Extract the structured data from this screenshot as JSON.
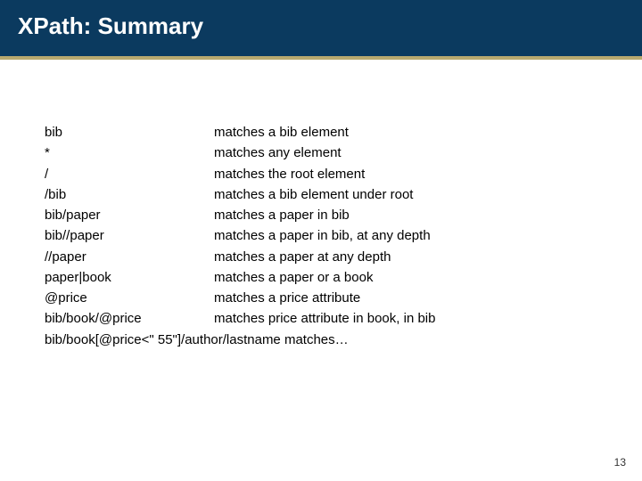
{
  "title": "XPath: Summary",
  "rows": [
    {
      "l": "bib",
      "r": "matches a bib element"
    },
    {
      "l": "*",
      "r": "matches any element"
    },
    {
      "l": "/",
      "r": "matches the root element"
    },
    {
      "l": "/bib",
      "r": "matches a bib element under root"
    },
    {
      "l": "bib/paper",
      "r": "matches a paper in bib"
    },
    {
      "l": "bib//paper",
      "r": "matches a paper in bib, at any depth"
    },
    {
      "l": "//paper",
      "r": "matches a paper at any depth"
    },
    {
      "l": "paper|book",
      "r": "matches a paper or a book"
    },
    {
      "l": "@price",
      "r": "matches a price attribute"
    },
    {
      "l": "bib/book/@price",
      "r": "matches price attribute in book, in bib"
    }
  ],
  "lastRow": "bib/book[@price<\" 55\"]/author/lastname  matches…",
  "pageNumber": "13"
}
